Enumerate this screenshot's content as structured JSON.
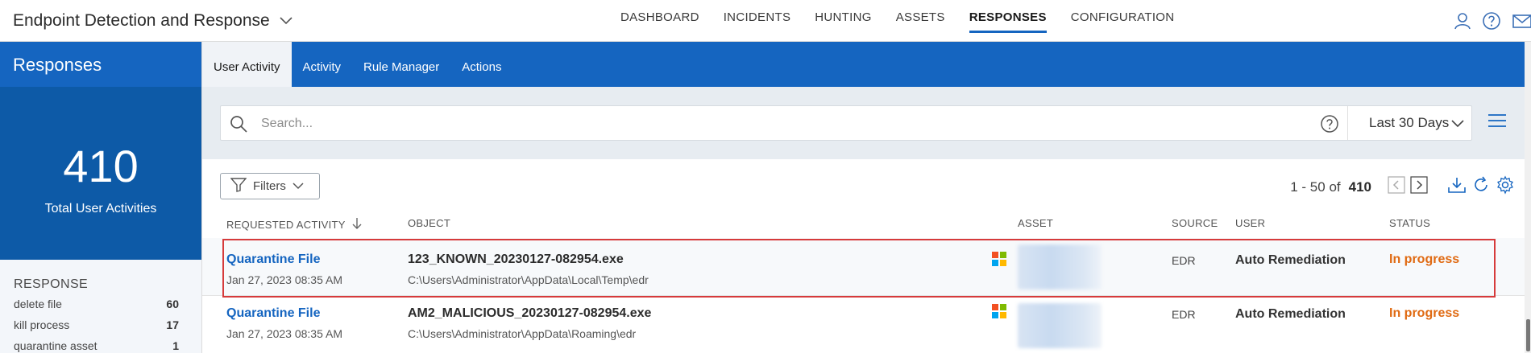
{
  "header": {
    "app_title": "Endpoint Detection and Response",
    "nav": [
      "DASHBOARD",
      "INCIDENTS",
      "HUNTING",
      "ASSETS",
      "RESPONSES",
      "CONFIGURATION"
    ],
    "nav_active": "RESPONSES",
    "icons": [
      "user-icon",
      "help-icon",
      "mail-icon"
    ]
  },
  "sidebar": {
    "title": "Responses",
    "stat_value": "410",
    "stat_label": "Total User Activities",
    "section_title": "RESPONSE",
    "items": [
      {
        "label": "delete file",
        "count": "60"
      },
      {
        "label": "kill process",
        "count": "17"
      },
      {
        "label": "quarantine asset",
        "count": "1"
      }
    ]
  },
  "tabs": [
    {
      "label": "User Activity",
      "active": true
    },
    {
      "label": "Activity",
      "active": false
    },
    {
      "label": "Rule Manager",
      "active": false
    },
    {
      "label": "Actions",
      "active": false
    }
  ],
  "search": {
    "placeholder": "Search...",
    "value": "",
    "time_range": "Last 30 Days"
  },
  "toolbar": {
    "filters_label": "Filters",
    "pager_range": "1 - 50 of",
    "pager_total": "410"
  },
  "table": {
    "columns": [
      "REQUESTED ACTIVITY",
      "OBJECT",
      "ASSET",
      "SOURCE",
      "USER",
      "STATUS"
    ],
    "sort_column": "REQUESTED ACTIVITY",
    "rows": [
      {
        "activity": "Quarantine File",
        "date": "Jan 27, 2023 08:35 AM",
        "object": "123_KNOWN_20230127-082954.exe",
        "path": "C:\\Users\\Administrator\\AppData\\Local\\Temp\\edr",
        "source": "EDR",
        "user": "Auto Remediation",
        "status": "In progress",
        "highlighted": true
      },
      {
        "activity": "Quarantine File",
        "date": "Jan 27, 2023 08:35 AM",
        "object": "AM2_MALICIOUS_20230127-082954.exe",
        "path": "C:\\Users\\Administrator\\AppData\\Roaming\\edr",
        "source": "EDR",
        "user": "Auto Remediation",
        "status": "In progress",
        "highlighted": false
      }
    ]
  },
  "colors": {
    "brand_blue": "#1565c0",
    "stat_blue": "#0d5aa7",
    "status_orange": "#e06a12",
    "highlight_red": "#d63b3b"
  }
}
